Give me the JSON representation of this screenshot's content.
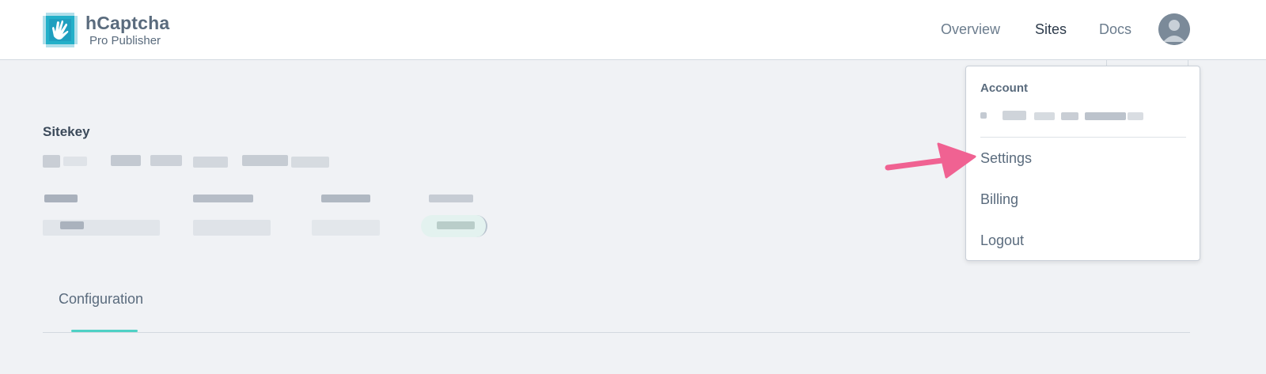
{
  "brand": {
    "name": "hCaptcha",
    "subtitle": "Pro Publisher",
    "logo_icon": "hcaptcha-hand-logo-icon"
  },
  "nav": {
    "items": [
      {
        "label": "Overview",
        "active": false
      },
      {
        "label": "Sites",
        "active": true
      },
      {
        "label": "Docs",
        "active": false
      }
    ],
    "avatar_icon": "user-avatar-icon"
  },
  "site": {
    "sitekey_label": "Sitekey"
  },
  "tabs": {
    "items": [
      {
        "label": "Configuration",
        "active": true
      }
    ]
  },
  "account_menu": {
    "header": "Account",
    "items": [
      {
        "label": "Settings"
      },
      {
        "label": "Billing"
      },
      {
        "label": "Logout"
      }
    ]
  },
  "annotation": {
    "arrow_color": "#f06292"
  },
  "colors": {
    "accent_teal": "#4fd1c5",
    "background": "#f0f2f5"
  }
}
